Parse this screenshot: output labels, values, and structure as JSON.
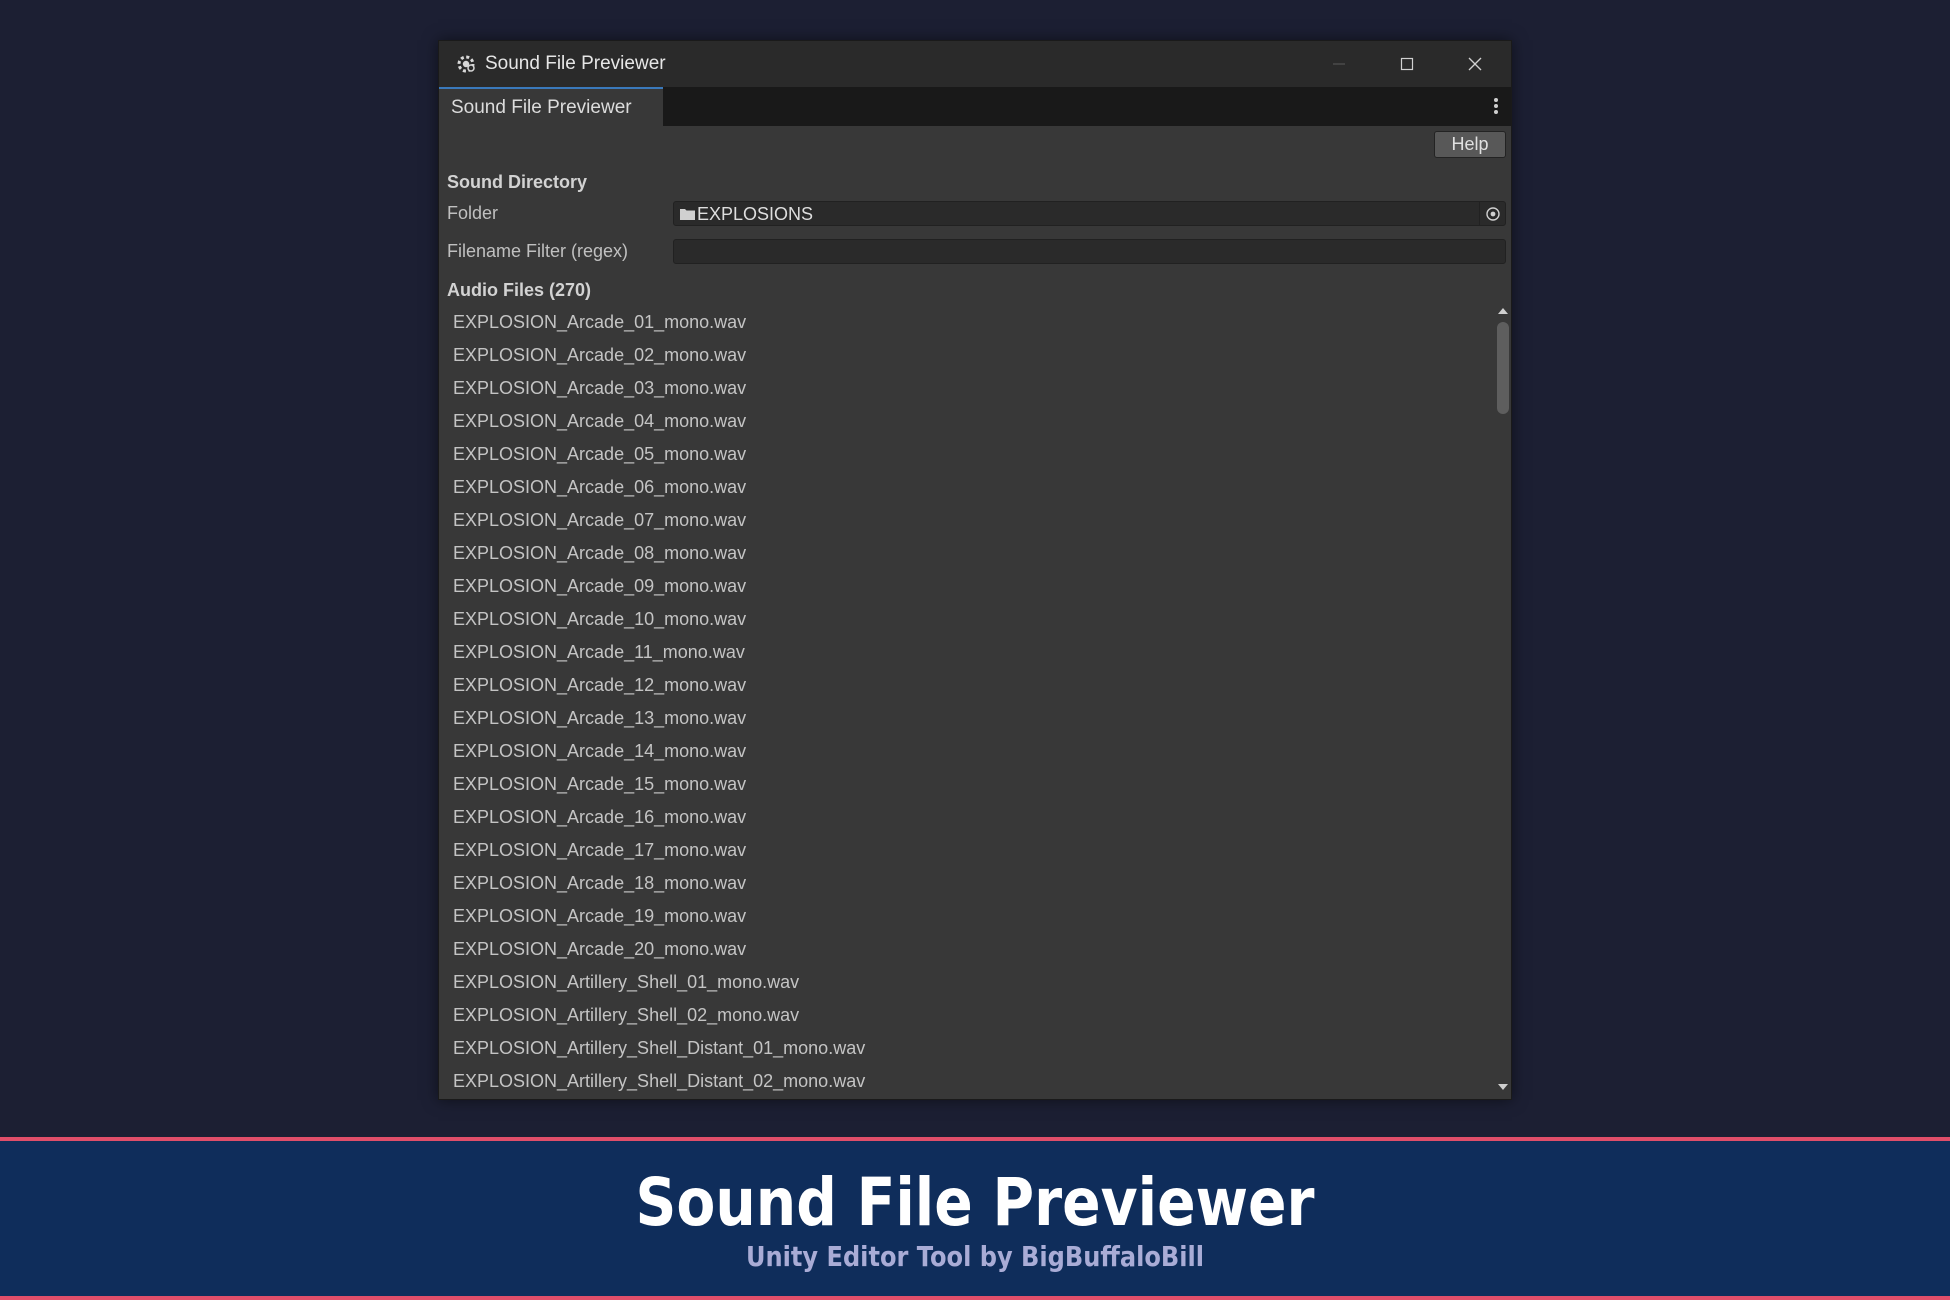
{
  "window": {
    "title": "Sound File Previewer",
    "tab_label": "Sound File Previewer"
  },
  "toolbar": {
    "help_label": "Help"
  },
  "sound_directory": {
    "header": "Sound Directory",
    "folder_label": "Folder",
    "folder_value": "EXPLOSIONS",
    "filter_label": "Filename Filter (regex)",
    "filter_value": ""
  },
  "audio_files": {
    "header": "Audio Files  (270)",
    "items": [
      "EXPLOSION_Arcade_01_mono.wav",
      "EXPLOSION_Arcade_02_mono.wav",
      "EXPLOSION_Arcade_03_mono.wav",
      "EXPLOSION_Arcade_04_mono.wav",
      "EXPLOSION_Arcade_05_mono.wav",
      "EXPLOSION_Arcade_06_mono.wav",
      "EXPLOSION_Arcade_07_mono.wav",
      "EXPLOSION_Arcade_08_mono.wav",
      "EXPLOSION_Arcade_09_mono.wav",
      "EXPLOSION_Arcade_10_mono.wav",
      "EXPLOSION_Arcade_11_mono.wav",
      "EXPLOSION_Arcade_12_mono.wav",
      "EXPLOSION_Arcade_13_mono.wav",
      "EXPLOSION_Arcade_14_mono.wav",
      "EXPLOSION_Arcade_15_mono.wav",
      "EXPLOSION_Arcade_16_mono.wav",
      "EXPLOSION_Arcade_17_mono.wav",
      "EXPLOSION_Arcade_18_mono.wav",
      "EXPLOSION_Arcade_19_mono.wav",
      "EXPLOSION_Arcade_20_mono.wav",
      "EXPLOSION_Artillery_Shell_01_mono.wav",
      "EXPLOSION_Artillery_Shell_02_mono.wav",
      "EXPLOSION_Artillery_Shell_Distant_01_mono.wav",
      "EXPLOSION_Artillery_Shell_Distant_02_mono.wav"
    ]
  },
  "banner": {
    "title": "Sound File Previewer",
    "subtitle": "Unity Editor Tool by BigBuffaloBill"
  },
  "icons": {
    "app": "unity-gear-icon",
    "folder": "folder-icon",
    "picker": "object-picker-icon",
    "minimize": "minimize-icon",
    "maximize": "maximize-icon",
    "close": "close-icon",
    "menu": "kebab-menu-icon"
  },
  "colors": {
    "page_background": "#1c1f33",
    "window_background": "#383838",
    "tab_accent": "#3a79bb",
    "banner_background": "#0f2d5b",
    "banner_border": "#e04e6a",
    "banner_subtitle": "#a9acd6"
  }
}
